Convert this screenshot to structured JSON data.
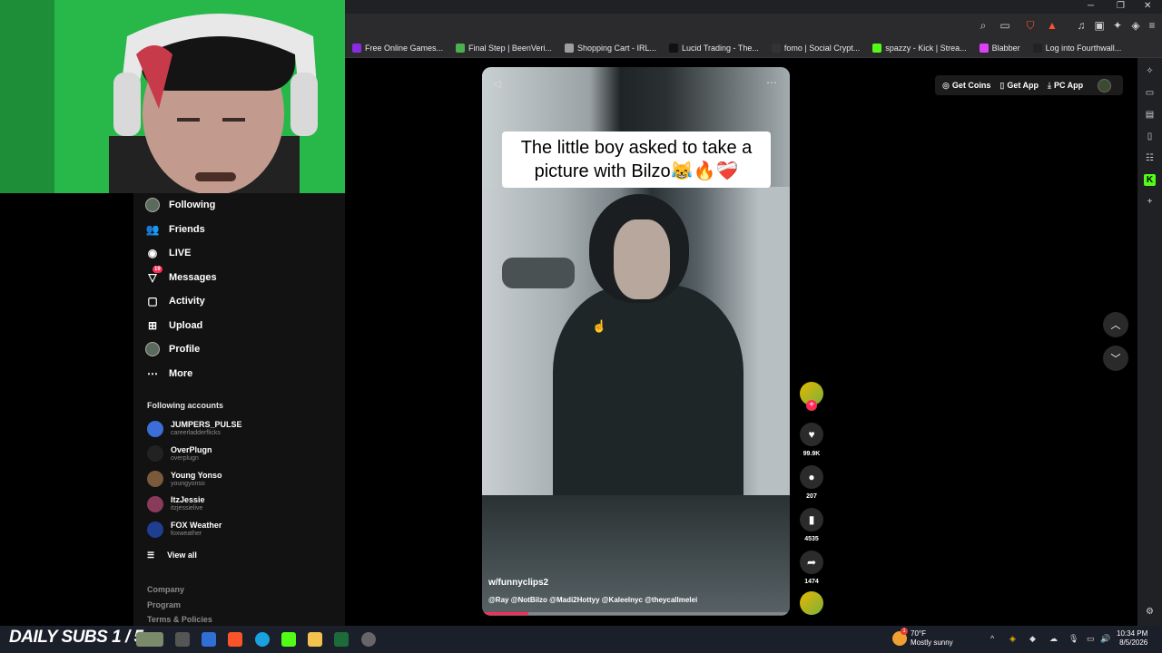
{
  "bookmarks": [
    {
      "label": "Free Online Games...",
      "color": "#8a2be2"
    },
    {
      "label": "Final Step | BeenVeri...",
      "color": "#4caf50"
    },
    {
      "label": "Shopping Cart - IRL...",
      "color": "#9e9e9e"
    },
    {
      "label": "Lucid Trading - The...",
      "color": "#111111"
    },
    {
      "label": "fomo | Social Crypt...",
      "color": "#333333"
    },
    {
      "label": "spazzy - Kick | Strea...",
      "color": "#53fc18"
    },
    {
      "label": "Blabber",
      "color": "#e040fb"
    },
    {
      "label": "Log into Fourthwall...",
      "color": "#222222"
    }
  ],
  "sidebar": {
    "nav": [
      {
        "label": "Following",
        "icon": "following-avatar"
      },
      {
        "label": "Friends",
        "icon": "friends-icon"
      },
      {
        "label": "LIVE",
        "icon": "live-icon"
      },
      {
        "label": "Messages",
        "icon": "messages-icon",
        "badge": "19"
      },
      {
        "label": "Activity",
        "icon": "activity-icon"
      },
      {
        "label": "Upload",
        "icon": "upload-icon"
      },
      {
        "label": "Profile",
        "icon": "profile-avatar"
      },
      {
        "label": "More",
        "icon": "more-icon"
      }
    ],
    "following_title": "Following accounts",
    "accounts": [
      {
        "name": "JUMPERS_PULSE",
        "handle": "careerladderflicks",
        "color": "#3b6ed8"
      },
      {
        "name": "OverPlugn",
        "handle": "overplugn",
        "color": "#222222"
      },
      {
        "name": "Young Yonso",
        "handle": "youngyonso",
        "color": "#7a5a3a"
      },
      {
        "name": "ItzJessie",
        "handle": "itzjessielive",
        "color": "#8a3a5a"
      },
      {
        "name": "FOX Weather",
        "handle": "foxweather",
        "color": "#1f3e8f"
      }
    ],
    "view_all": "View all",
    "footer": [
      "Company",
      "Program",
      "Terms & Policies"
    ]
  },
  "video": {
    "caption": "The little boy asked to take a picture with Bilzo😹🔥❤️‍🩹",
    "author": "w/funnyclips2",
    "description": "@Ray @NotBilzo @Madi2Hottyy @Kaleelnyc @theycallmelei",
    "progress": 0.15
  },
  "actions": {
    "likes": "99.9K",
    "comments": "207",
    "saves": "4535",
    "shares": "1474"
  },
  "appbar": {
    "get_coins": "Get Coins",
    "get_app": "Get App",
    "pc_app": "PC App"
  },
  "taskbar": {
    "subs": "DAILY SUBS 1 / 5",
    "weather_temp": "70°F",
    "weather_desc": "Mostly sunny",
    "time": "10:34 PM",
    "date": "8/5/2026",
    "weather_badge": "1"
  }
}
